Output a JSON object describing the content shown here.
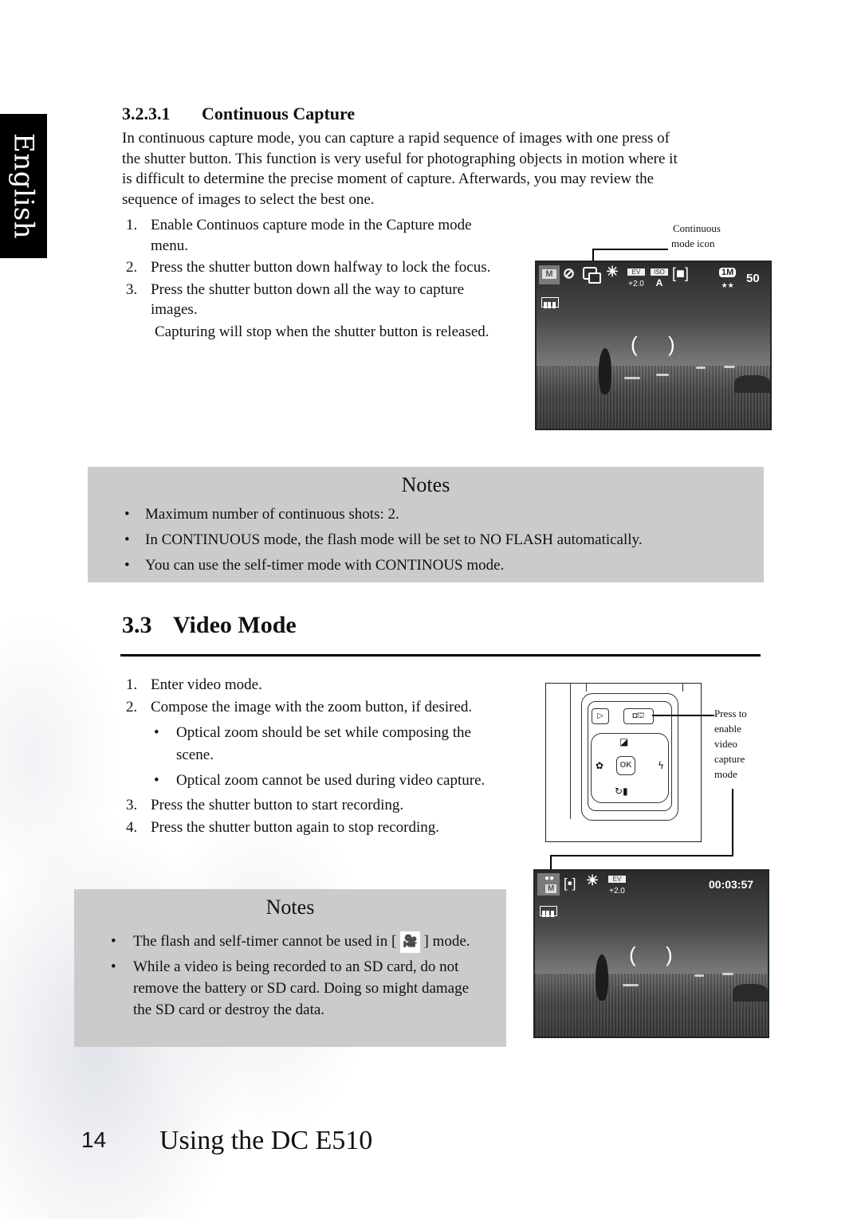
{
  "sidebar": {
    "language_tab": "English"
  },
  "continuous_capture": {
    "number": "3.2.3.1",
    "title": "Continuous Capture",
    "intro_lines": [
      "In continuous capture mode, you can capture a rapid sequence of images with one press of",
      "the shutter button. This function is very useful for photographing objects in motion where it",
      "is difficult to determine the precise moment of capture. Afterwards, you may review the",
      "sequence of images to select the best one."
    ],
    "steps": [
      {
        "num": "1.",
        "text": "Enable Continuos capture mode in the Capture mode menu."
      },
      {
        "num": "2.",
        "text": "Press the shutter button down halfway to lock the focus."
      },
      {
        "num": "3.",
        "text": "Press the shutter button down all the way to capture images."
      }
    ],
    "step_note": "Capturing will stop when the shutter button is released.",
    "callout": {
      "line1": "Continuous",
      "line2": "mode icon"
    },
    "lcd": {
      "mode_icon": "M",
      "ev_label": "EV",
      "ev_value": "+2.0",
      "iso_label": "ISO",
      "resolution": "1M",
      "quality_stars": "★★",
      "shots_remaining": "50",
      "icons": [
        "camera-m-mode-icon",
        "no-flash-icon",
        "continuous-mode-icon",
        "white-balance-auto-icon",
        "ev-icon",
        "iso-auto-icon",
        "focus-area-icon",
        "battery-full-icon"
      ]
    }
  },
  "notes1": {
    "title": "Notes",
    "items": [
      "Maximum number of continuous shots: 2.",
      "In CONTINUOUS mode, the flash mode will be set to NO FLASH automatically.",
      "You can use the self-timer mode with CONTINOUS mode."
    ]
  },
  "video_mode": {
    "number": "3.3",
    "title": "Video Mode",
    "steps": [
      {
        "num": "1.",
        "text": "Enter video mode."
      },
      {
        "num": "2.",
        "text": "Compose the image with the zoom button, if desired.",
        "subs": [
          "Optical zoom should be set while composing the scene.",
          "Optical zoom cannot be used during video capture."
        ]
      },
      {
        "num": "3.",
        "text": "Press the shutter button to start recording."
      },
      {
        "num": "4.",
        "text": "Press the shutter button again to stop recording."
      }
    ],
    "callout": {
      "lines": [
        "Press to",
        "enable",
        "video",
        "capture",
        "mode"
      ]
    },
    "camera_buttons": {
      "ok_label": "OK"
    },
    "lcd": {
      "mode_icon": "M",
      "ev_label": "EV",
      "ev_value": "+2.0",
      "time_remaining": "00:03:57",
      "icons": [
        "video-m-mode-icon",
        "spot-focus-icon",
        "white-balance-auto-icon",
        "ev-icon",
        "battery-full-icon"
      ]
    }
  },
  "notes2": {
    "title": "Notes",
    "items": [
      {
        "before": "The flash and self-timer cannot be used in [",
        "icon": "video-camera-icon",
        "after": "] mode."
      },
      {
        "text": "While a video is being recorded to an SD card, do not remove the battery or SD card. Doing so might damage the SD card or destroy the data."
      }
    ]
  },
  "footer": {
    "page_number": "14",
    "title": "Using the DC E510"
  }
}
